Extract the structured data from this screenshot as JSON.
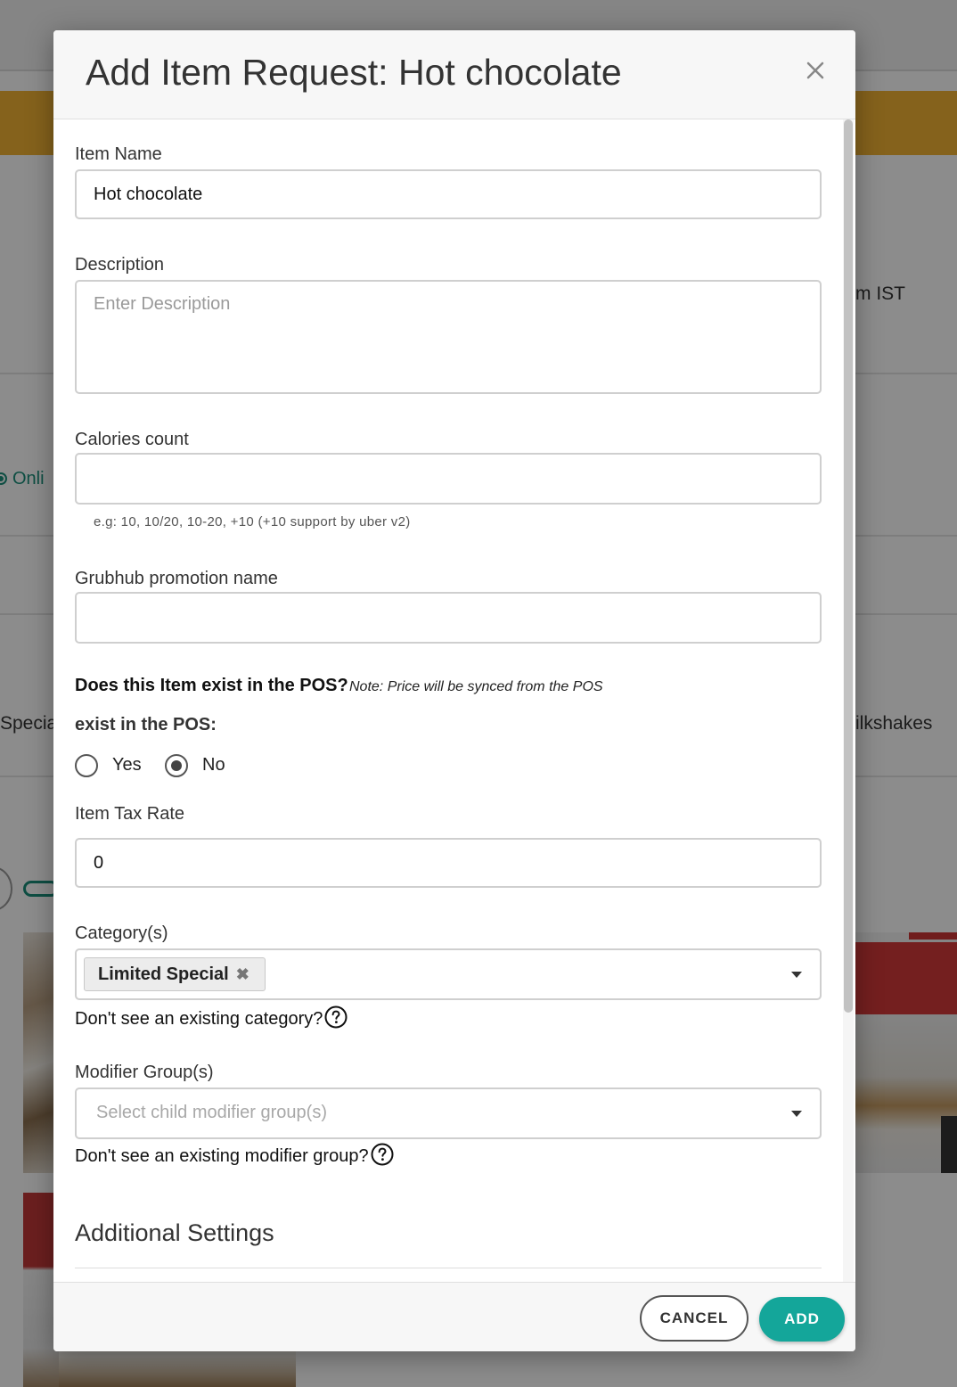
{
  "background": {
    "header_right_text": "m IST",
    "online_label": "Onli",
    "left_category_text": "Specia",
    "right_category_text": "ilkshakes"
  },
  "modal": {
    "title": "Add Item Request: Hot chocolate",
    "close_icon": "close-icon"
  },
  "form": {
    "item_name": {
      "label": "Item Name",
      "value": "Hot chocolate"
    },
    "description": {
      "label": "Description",
      "placeholder": "Enter Description",
      "value": ""
    },
    "calories": {
      "label": "Calories count",
      "value": "",
      "hint": "e.g: 10, 10/20, 10-20, +10 (+10 support by uber v2)"
    },
    "grubhub_promo": {
      "label": "Grubhub promotion name",
      "value": ""
    },
    "pos": {
      "question": "Does this Item exist in the POS?",
      "note": "Note: Price will be synced from the POS",
      "exist_label": "exist in the POS:",
      "options": [
        {
          "label": "Yes",
          "checked": false
        },
        {
          "label": "No",
          "checked": true
        }
      ]
    },
    "tax_rate": {
      "label": "Item Tax Rate",
      "value": "0"
    },
    "categories": {
      "label": "Category(s)",
      "selected": [
        "Limited Special"
      ],
      "remove_icon": "✖",
      "help_text": "Don't see an existing category?"
    },
    "modifier_groups": {
      "label": "Modifier Group(s)",
      "placeholder": "Select child modifier group(s)",
      "help_text": "Don't see an existing modifier group?"
    },
    "additional_settings_title": "Additional Settings"
  },
  "footer": {
    "cancel_label": "CANCEL",
    "add_label": "ADD"
  },
  "colors": {
    "accent": "#14a69a",
    "banner": "#f2b233"
  }
}
